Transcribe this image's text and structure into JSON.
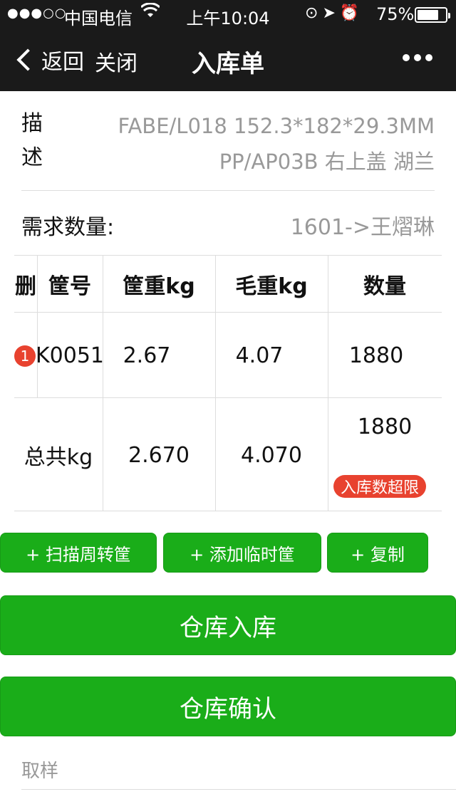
{
  "status_bar": {
    "signal": "●●●○○",
    "carrier": "中国电信",
    "time": "上午10:04",
    "battery_percent": "75%",
    "battery_level": 0.75,
    "icons": [
      "wifi-icon",
      "lock-rotation-icon",
      "location-arrow-icon",
      "alarm-icon"
    ]
  },
  "nav": {
    "back_label": "返回",
    "close_label": "关闭",
    "title": "入库单"
  },
  "description": {
    "label": "描述",
    "text": "FABE/L018 152.3*182*29.3MM PP/AP03B 右上盖 湖兰"
  },
  "quantity": {
    "label": "需求数量:",
    "value": "1601->王熠琳"
  },
  "table": {
    "headers": [
      "删",
      "筐号",
      "筐重kg",
      "毛重kg",
      "数量"
    ],
    "rows": [
      {
        "index": "1",
        "basket_no": "K0051",
        "basket_weight": "2.67",
        "gross_weight": "4.07",
        "quantity": "1880"
      }
    ],
    "total": {
      "label": "总共kg",
      "basket_weight": "2.670",
      "gross_weight": "4.070",
      "quantity": "1880",
      "warning": "入库数超限"
    }
  },
  "actions": {
    "scan_label": "+ 扫描周转筐",
    "add_temp_label": "+ 添加临时筐",
    "copy_label": "+ 复制",
    "warehouse_in_label": "仓库入库",
    "warehouse_confirm_label": "仓库确认"
  },
  "sample_label": "取样",
  "colors": {
    "primary_green": "#1aad19",
    "badge_red": "#e8422f",
    "navbar": "#1a1a1a"
  }
}
